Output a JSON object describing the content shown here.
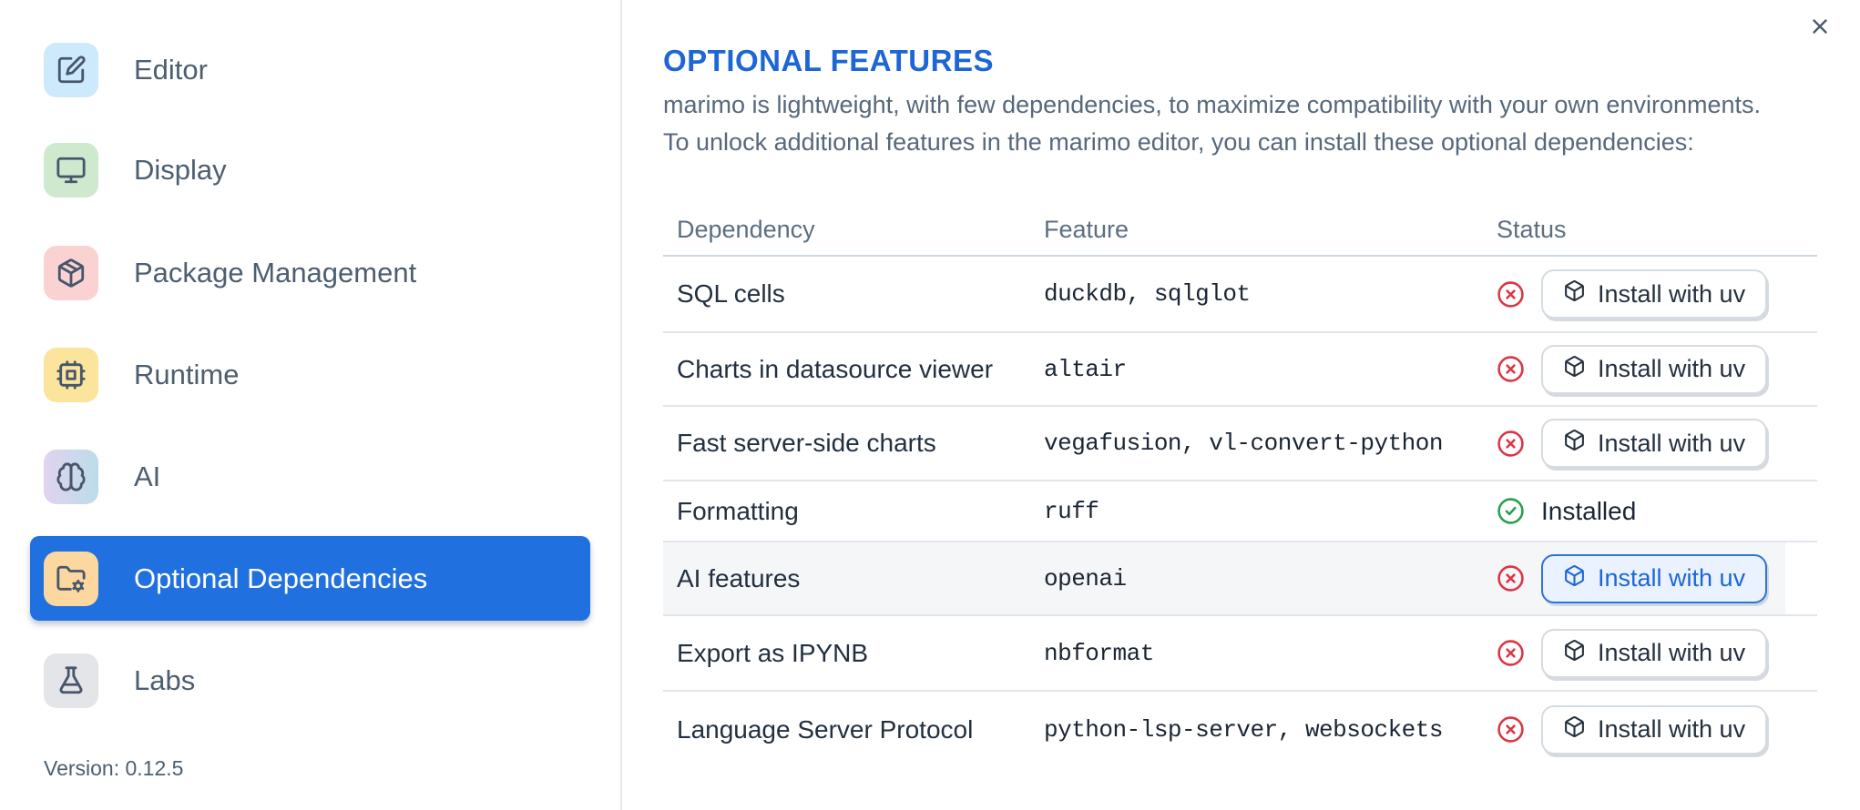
{
  "sidebar": {
    "items": [
      {
        "label": "Editor",
        "icon": "square-pen",
        "selected": false
      },
      {
        "label": "Display",
        "icon": "monitor",
        "selected": false
      },
      {
        "label": "Package Management",
        "icon": "package-box",
        "selected": false
      },
      {
        "label": "Runtime",
        "icon": "cpu",
        "selected": false
      },
      {
        "label": "AI",
        "icon": "brain",
        "selected": false
      },
      {
        "label": "Optional Dependencies",
        "icon": "folder-cog",
        "selected": true
      },
      {
        "label": "Labs",
        "icon": "flask",
        "selected": false
      }
    ],
    "version_label": "Version: 0.12.5"
  },
  "dialog": {
    "title": "OPTIONAL FEATURES",
    "description": [
      "marimo is lightweight, with few dependencies, to maximize compatibility with your own environments.",
      "To unlock additional features in the marimo editor, you can install these optional dependencies:"
    ]
  },
  "table": {
    "headers": {
      "dependency": "Dependency",
      "feature": "Feature",
      "status": "Status"
    },
    "rows": [
      {
        "dependency": "SQL cells",
        "feature": "duckdb, sqlglot",
        "status": "not installed",
        "action_label": "Install with uv"
      },
      {
        "dependency": "Charts in datasource viewer",
        "feature": "altair",
        "status": "not installed",
        "action_label": "Install with uv"
      },
      {
        "dependency": "Fast server-side charts",
        "feature": "vegafusion, vl-convert-python",
        "status": "not installed",
        "action_label": "Install with uv"
      },
      {
        "dependency": "Formatting",
        "feature": "ruff",
        "status": "installed",
        "status_label": "Installed"
      },
      {
        "dependency": "AI features",
        "feature": "openai",
        "status": "not installed",
        "action_label": "Install with uv",
        "highlighted": true
      },
      {
        "dependency": "Export as IPYNB",
        "feature": "nbformat",
        "status": "not installed",
        "action_label": "Install with uv"
      },
      {
        "dependency": "Language Server Protocol",
        "feature": "python-lsp-server, websockets",
        "status": "not installed",
        "action_label": "Install with uv"
      }
    ]
  },
  "colors": {
    "accent_blue": "#2070e0",
    "title_blue": "#1d66d6",
    "error_red": "#dc3545",
    "success_green": "#27a04d",
    "row_highlight": "#f5f6f8",
    "icon_bg_editor": "#cde9fc",
    "icon_bg_display": "#cfe9cf",
    "icon_bg_package": "#fad2d2",
    "icon_bg_runtime": "#fbe49c",
    "icon_bg_ai_gradient": "#e2d3f0 → #bbdce9",
    "icon_bg_optional_dependencies": "#fcd7a0",
    "icon_bg_labs": "#e4e5e9"
  }
}
